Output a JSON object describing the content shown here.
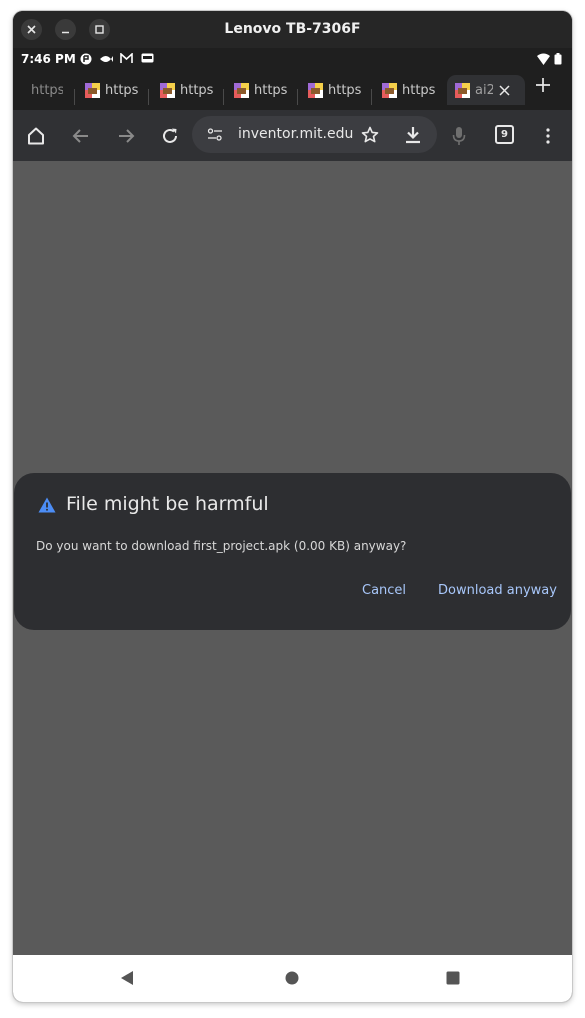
{
  "window": {
    "title": "Lenovo TB-7306F",
    "controls": [
      "close-icon",
      "minimize-icon",
      "maximize-icon"
    ]
  },
  "status_bar": {
    "time": "7:46 PM"
  },
  "tabs": [
    {
      "label": "https",
      "favicon": "app-inventor-icon",
      "active": false
    },
    {
      "label": "https",
      "favicon": "app-inventor-icon",
      "active": false
    },
    {
      "label": "https",
      "favicon": "app-inventor-icon",
      "active": false
    },
    {
      "label": "https",
      "favicon": "app-inventor-icon",
      "active": false
    },
    {
      "label": "https",
      "favicon": "app-inventor-icon",
      "active": false
    },
    {
      "label": "https",
      "favicon": "app-inventor-icon",
      "active": false
    },
    {
      "label": "ai2",
      "favicon": "app-inventor-icon",
      "active": true
    }
  ],
  "toolbar": {
    "url": "inventor.mit.edu",
    "tab_count": "9"
  },
  "dialog": {
    "title": "File might be harmful",
    "message": "Do you want to download first_project.apk (0.00 KB) anyway?",
    "cancel_label": "Cancel",
    "download_label": "Download anyway"
  },
  "colors": {
    "accent": "#a8c7fa",
    "warning": "#4c8df6",
    "content_background": "#5a5a5a"
  }
}
